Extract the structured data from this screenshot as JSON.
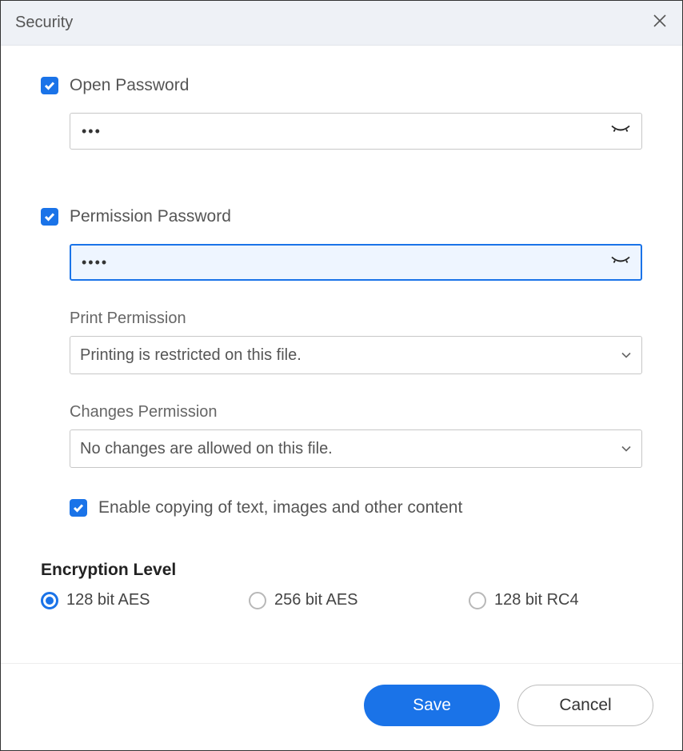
{
  "dialog": {
    "title": "Security"
  },
  "open_password": {
    "checked": true,
    "label": "Open Password",
    "value": "•••"
  },
  "permission_password": {
    "checked": true,
    "label": "Permission Password",
    "value": "••••",
    "focused": true
  },
  "print_permission": {
    "label": "Print Permission",
    "value": "Printing is restricted on this file."
  },
  "changes_permission": {
    "label": "Changes Permission",
    "value": "No changes are allowed on this file."
  },
  "enable_copy": {
    "checked": true,
    "label": "Enable copying of text, images and other content"
  },
  "encryption": {
    "title": "Encryption Level",
    "options": [
      {
        "label": "128 bit AES",
        "selected": true
      },
      {
        "label": "256 bit AES",
        "selected": false
      },
      {
        "label": "128 bit RC4",
        "selected": false
      }
    ]
  },
  "footer": {
    "save": "Save",
    "cancel": "Cancel"
  }
}
